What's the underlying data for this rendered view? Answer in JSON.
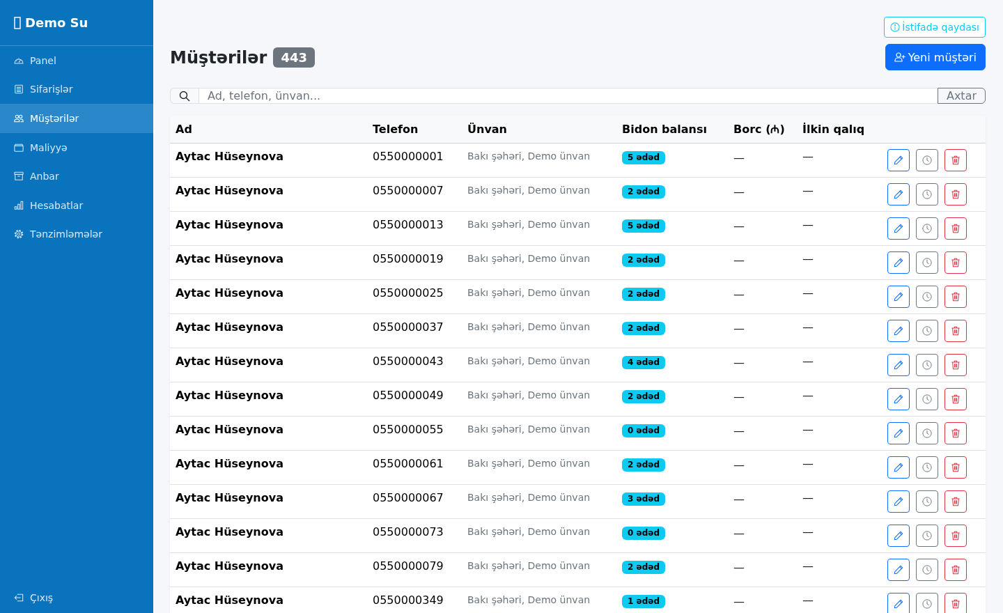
{
  "sidebar": {
    "brand": "Demo Su",
    "items": [
      {
        "label": "Panel",
        "selected": false
      },
      {
        "label": "Sifarişlər",
        "selected": false
      },
      {
        "label": "Müştərilər",
        "selected": true
      },
      {
        "label": "Maliyyə",
        "selected": false
      },
      {
        "label": "Anbar",
        "selected": false
      },
      {
        "label": "Hesabatlar",
        "selected": false
      },
      {
        "label": "Tənzimləmələr",
        "selected": false
      }
    ],
    "logout": "Çıxış"
  },
  "header": {
    "title": "Müştərilər",
    "count": "443",
    "help_button": "İstifadə qaydası",
    "new_button": "Yeni müştəri"
  },
  "search": {
    "placeholder": "Ad, telefon, ünvan...",
    "button": "Axtar"
  },
  "table": {
    "columns": [
      "Ad",
      "Telefon",
      "Ünvan",
      "Bidon balansı",
      "Borc (₼)",
      "İlkin qalıq"
    ],
    "rows": [
      {
        "name": "Aytac Hüseynova",
        "phone": "0550000001",
        "address": "Bakı şəhəri, Demo ünvan",
        "balance": "5 ədəd",
        "debt": "—",
        "initial": "—"
      },
      {
        "name": "Aytac Hüseynova",
        "phone": "0550000007",
        "address": "Bakı şəhəri, Demo ünvan",
        "balance": "2 ədəd",
        "debt": "—",
        "initial": "—"
      },
      {
        "name": "Aytac Hüseynova",
        "phone": "0550000013",
        "address": "Bakı şəhəri, Demo ünvan",
        "balance": "5 ədəd",
        "debt": "—",
        "initial": "—"
      },
      {
        "name": "Aytac Hüseynova",
        "phone": "0550000019",
        "address": "Bakı şəhəri, Demo ünvan",
        "balance": "2 ədəd",
        "debt": "—",
        "initial": "—"
      },
      {
        "name": "Aytac Hüseynova",
        "phone": "0550000025",
        "address": "Bakı şəhəri, Demo ünvan",
        "balance": "2 ədəd",
        "debt": "—",
        "initial": "—"
      },
      {
        "name": "Aytac Hüseynova",
        "phone": "0550000037",
        "address": "Bakı şəhəri, Demo ünvan",
        "balance": "2 ədəd",
        "debt": "—",
        "initial": "—"
      },
      {
        "name": "Aytac Hüseynova",
        "phone": "0550000043",
        "address": "Bakı şəhəri, Demo ünvan",
        "balance": "4 ədəd",
        "debt": "—",
        "initial": "—"
      },
      {
        "name": "Aytac Hüseynova",
        "phone": "0550000049",
        "address": "Bakı şəhəri, Demo ünvan",
        "balance": "2 ədəd",
        "debt": "—",
        "initial": "—"
      },
      {
        "name": "Aytac Hüseynova",
        "phone": "0550000055",
        "address": "Bakı şəhəri, Demo ünvan",
        "balance": "0 ədəd",
        "debt": "—",
        "initial": "—"
      },
      {
        "name": "Aytac Hüseynova",
        "phone": "0550000061",
        "address": "Bakı şəhəri, Demo ünvan",
        "balance": "2 ədəd",
        "debt": "—",
        "initial": "—"
      },
      {
        "name": "Aytac Hüseynova",
        "phone": "0550000067",
        "address": "Bakı şəhəri, Demo ünvan",
        "balance": "3 ədəd",
        "debt": "—",
        "initial": "—"
      },
      {
        "name": "Aytac Hüseynova",
        "phone": "0550000073",
        "address": "Bakı şəhəri, Demo ünvan",
        "balance": "0 ədəd",
        "debt": "—",
        "initial": "—"
      },
      {
        "name": "Aytac Hüseynova",
        "phone": "0550000079",
        "address": "Bakı şəhəri, Demo ünvan",
        "balance": "2 ədəd",
        "debt": "—",
        "initial": "—"
      },
      {
        "name": "Aytac Hüseynova",
        "phone": "0550000349",
        "address": "Bakı şəhəri, Demo ünvan",
        "balance": "1 ədəd",
        "debt": "—",
        "initial": "—"
      }
    ]
  }
}
